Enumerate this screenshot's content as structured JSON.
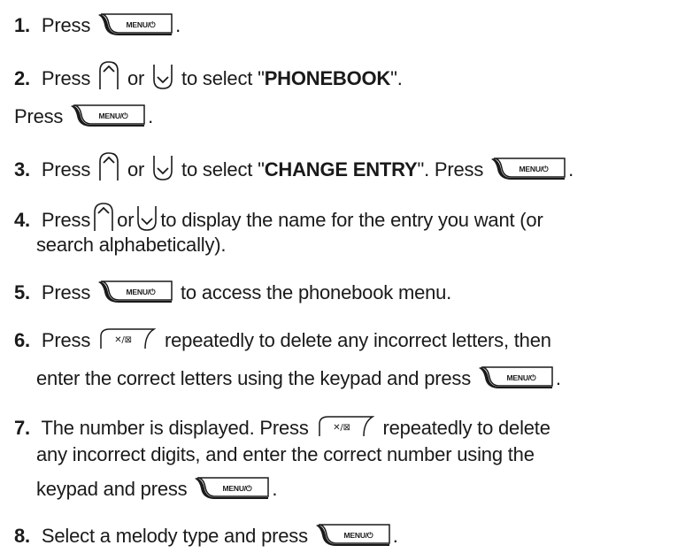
{
  "steps": [
    {
      "num": "1.",
      "pre": "Press",
      "post": "."
    },
    {
      "num": "2.",
      "pre": "Press",
      "or": "or",
      "mid": "to select \"",
      "target": "PHONEBOOK",
      "post": "\"."
    },
    {
      "cont_pre": "Press",
      "cont_post": "."
    },
    {
      "num": "3.",
      "pre": "Press",
      "or": "or",
      "mid": "to select \"",
      "target": "CHANGE ENTRY",
      "post": "\". Press",
      "end": "."
    },
    {
      "num": "4.",
      "pre": "Press",
      "or": "or",
      "mid": "to display the name for the entry you want (or",
      "line2": "search alphabetically)."
    },
    {
      "num": "5.",
      "pre": "Press",
      "post": "to access the phonebook menu."
    },
    {
      "num": "6.",
      "pre": "Press",
      "post": "repeatedly to delete any incorrect letters, then",
      "line2": "enter the correct letters using the keypad and press",
      "end": "."
    },
    {
      "num": "7.",
      "pre": "The number is displayed. Press",
      "post": "repeatedly to delete",
      "line2": "any incorrect digits, and enter the correct number using the",
      "line3": "keypad and press",
      "end": "."
    },
    {
      "num": "8.",
      "pre": "Select a melody type and press",
      "end": "."
    }
  ],
  "keys": {
    "menu_label": "MENU/⏻",
    "del_label": "✕/⊠",
    "menu_icon": "menu-power-key-icon",
    "up_icon": "navigate-up-key-icon",
    "down_icon": "navigate-down-key-icon",
    "del_icon": "delete-key-icon"
  }
}
